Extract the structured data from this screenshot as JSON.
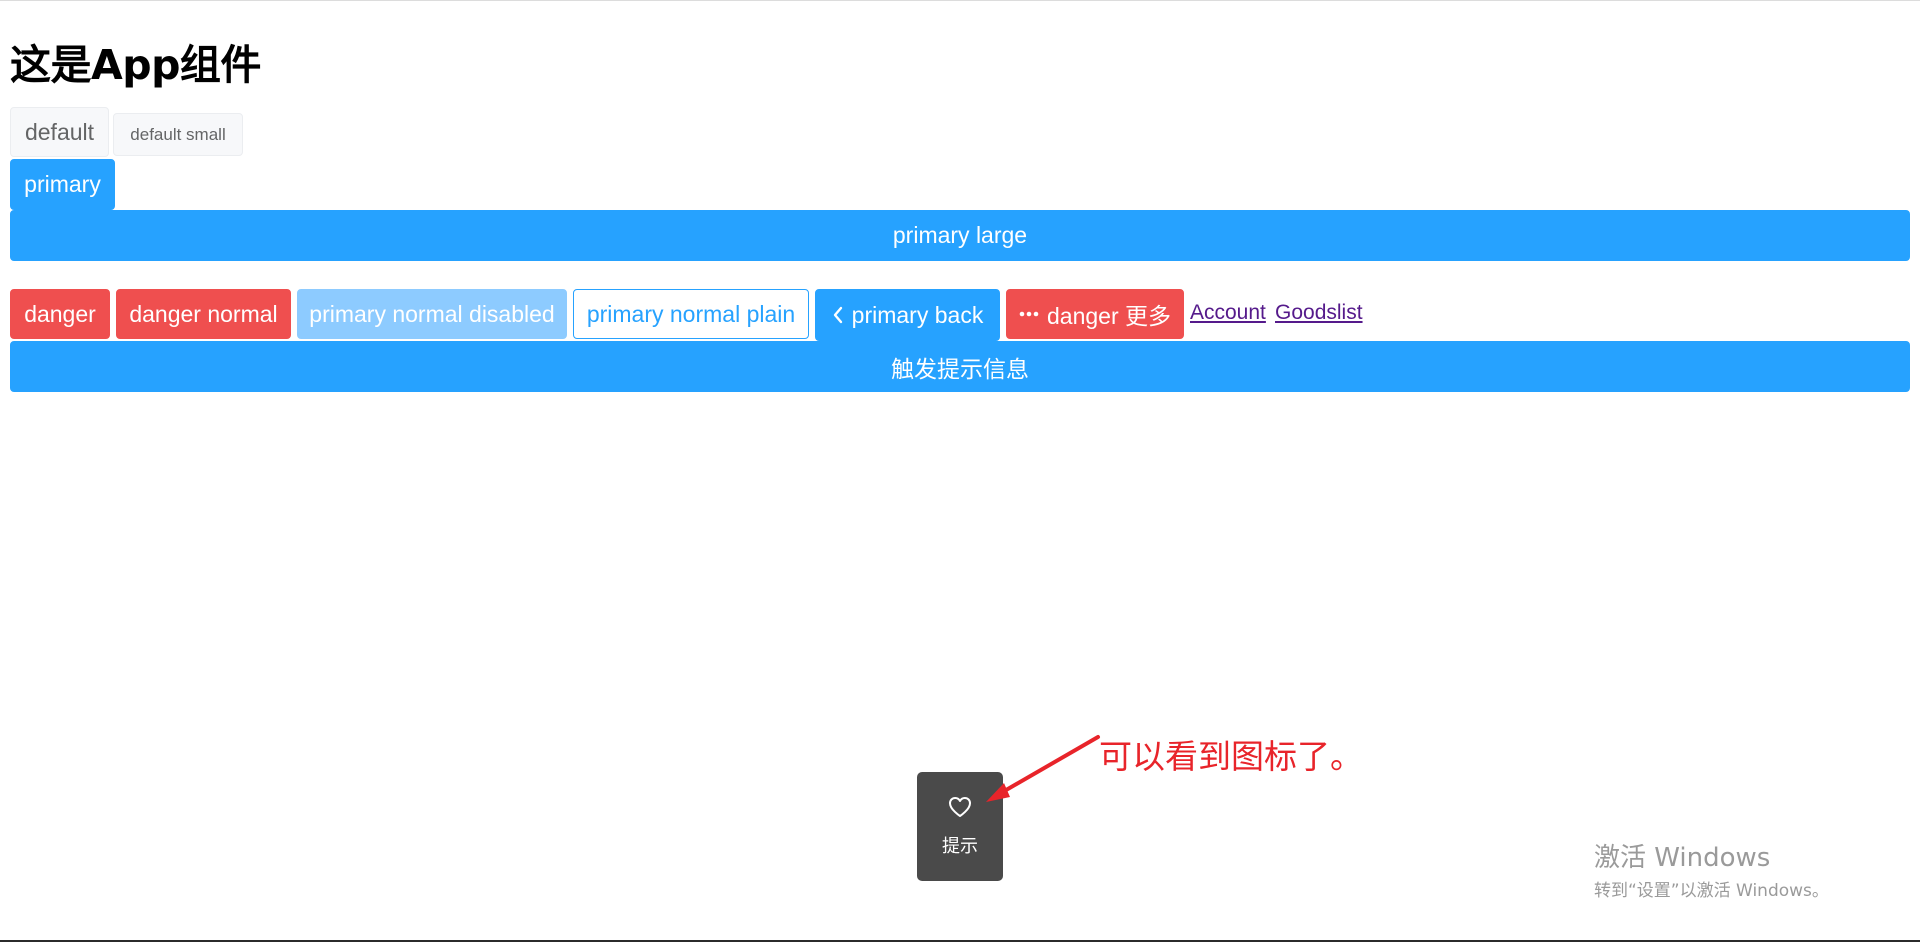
{
  "page": {
    "title": "这是App组件"
  },
  "buttons": {
    "default": "default",
    "default_small": "default small",
    "primary": "primary",
    "primary_large": "primary large",
    "danger": "danger",
    "danger_normal": "danger normal",
    "primary_normal_disabled": "primary normal disabled",
    "primary_normal_plain": "primary normal plain",
    "primary_back": "primary back",
    "danger_more": "danger 更多",
    "trigger_toast": "触发提示信息"
  },
  "links": {
    "account": "Account",
    "goodslist": "Goodslist"
  },
  "toast": {
    "icon": "heart-outline-icon",
    "text": "提示"
  },
  "annotation": {
    "text": "可以看到图标了。",
    "color": "#e8242a"
  },
  "watermark": {
    "line1": "激活 Windows",
    "line2": "转到“设置”以激活 Windows。"
  },
  "colors": {
    "primary": "#26a2ff",
    "danger": "#ef4f4f",
    "disabled": "#8dcbff",
    "toast_bg": "#4a4a4a"
  }
}
